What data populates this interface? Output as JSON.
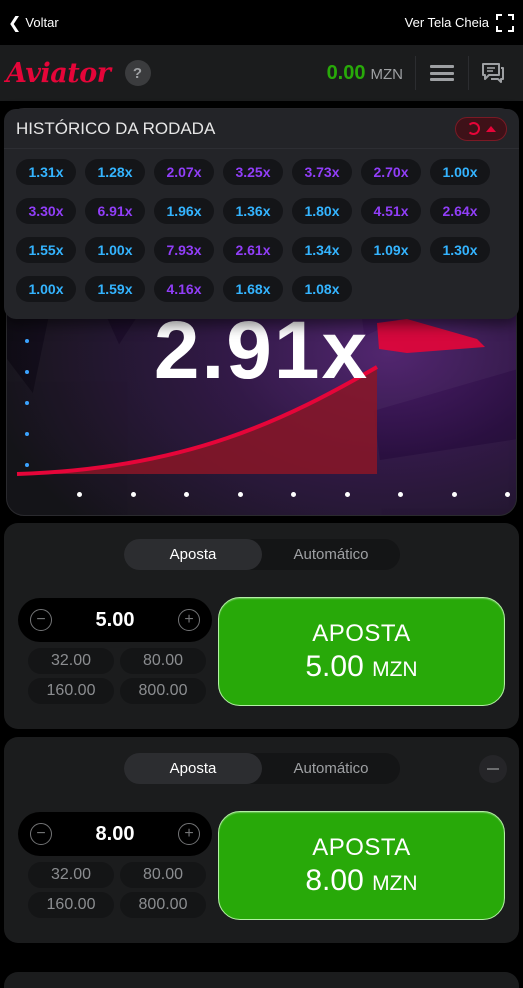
{
  "topbar": {
    "back_label": "Voltar",
    "fullscreen_label": "Ver Tela Cheia"
  },
  "header": {
    "logo": "Aviator",
    "help_label": "?",
    "balance_amount": "0.00",
    "balance_currency": "MZN"
  },
  "game": {
    "multiplier": "2.91x"
  },
  "history": {
    "title": "HISTÓRICO DA RODADA",
    "multipliers": [
      {
        "v": "1.31x",
        "c": "blue"
      },
      {
        "v": "1.28x",
        "c": "blue"
      },
      {
        "v": "2.07x",
        "c": "purple"
      },
      {
        "v": "3.25x",
        "c": "purple"
      },
      {
        "v": "3.73x",
        "c": "purple"
      },
      {
        "v": "2.70x",
        "c": "purple"
      },
      {
        "v": "1.00x",
        "c": "blue"
      },
      {
        "v": "3.30x",
        "c": "purple"
      },
      {
        "v": "6.91x",
        "c": "purple"
      },
      {
        "v": "1.96x",
        "c": "blue"
      },
      {
        "v": "1.36x",
        "c": "blue"
      },
      {
        "v": "1.80x",
        "c": "blue"
      },
      {
        "v": "4.51x",
        "c": "purple"
      },
      {
        "v": "2.64x",
        "c": "purple"
      },
      {
        "v": "1.55x",
        "c": "blue"
      },
      {
        "v": "1.00x",
        "c": "blue"
      },
      {
        "v": "7.93x",
        "c": "purple"
      },
      {
        "v": "2.61x",
        "c": "purple"
      },
      {
        "v": "1.34x",
        "c": "blue"
      },
      {
        "v": "1.09x",
        "c": "blue"
      },
      {
        "v": "1.30x",
        "c": "blue"
      },
      {
        "v": "1.00x",
        "c": "blue"
      },
      {
        "v": "1.59x",
        "c": "blue"
      },
      {
        "v": "4.16x",
        "c": "purple"
      },
      {
        "v": "1.68x",
        "c": "blue"
      },
      {
        "v": "1.08x",
        "c": "blue"
      }
    ]
  },
  "bet1": {
    "tab_bet": "Aposta",
    "tab_auto": "Automático",
    "amount": "5.00",
    "quick": [
      "32.00",
      "80.00",
      "160.00",
      "800.00"
    ],
    "button_label": "APOSTA",
    "button_amount": "5.00",
    "button_currency": "MZN"
  },
  "bet2": {
    "tab_bet": "Aposta",
    "tab_auto": "Automático",
    "amount": "8.00",
    "quick": [
      "32.00",
      "80.00",
      "160.00",
      "800.00"
    ],
    "button_label": "APOSTA",
    "button_amount": "8.00",
    "button_currency": "MZN"
  },
  "colors": {
    "brand_red": "#e50539",
    "bet_green": "#28a909",
    "chip_blue": "#34b4ff",
    "chip_purple": "#913ef8"
  },
  "icons": [
    "chevron-left-icon",
    "fullscreen-icon",
    "help-icon",
    "menu-icon",
    "chat-icon",
    "history-icon",
    "collapse-icon",
    "minus-icon",
    "plus-icon"
  ]
}
